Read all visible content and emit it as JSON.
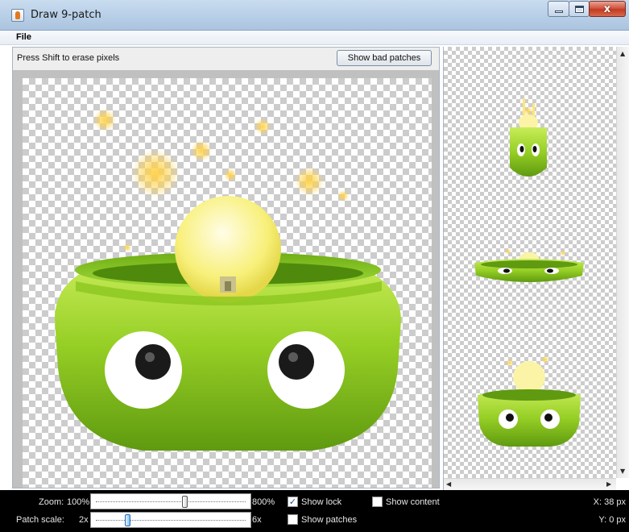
{
  "window": {
    "title": "Draw 9-patch",
    "buttons": {
      "minimize": "minimize",
      "maximize": "maximize",
      "close": "x"
    }
  },
  "menu": {
    "file": "File"
  },
  "editor": {
    "hint": "Press Shift to erase pixels",
    "bad_patches_button": "Show bad patches",
    "image_subject": "green droid bowl with glowing bulb"
  },
  "status": {
    "zoom_label": "Zoom:",
    "zoom_min": "100%",
    "zoom_max": "800%",
    "zoom_fraction": 0.6,
    "patch_label": "Patch scale:",
    "patch_min": "2x",
    "patch_max": "6x",
    "patch_fraction": 0.2,
    "show_lock": "Show lock",
    "show_lock_checked": true,
    "show_patches": "Show patches",
    "show_patches_checked": false,
    "show_content": "Show content",
    "show_content_checked": false,
    "x_readout": "X: 38 px",
    "y_readout": "Y: 0 px"
  },
  "colors": {
    "lime": "#8cc71f",
    "lime_dark": "#5f9a10",
    "bulb": "#fbf4a6",
    "glow": "#ffd24a",
    "status_bg": "#000000"
  }
}
